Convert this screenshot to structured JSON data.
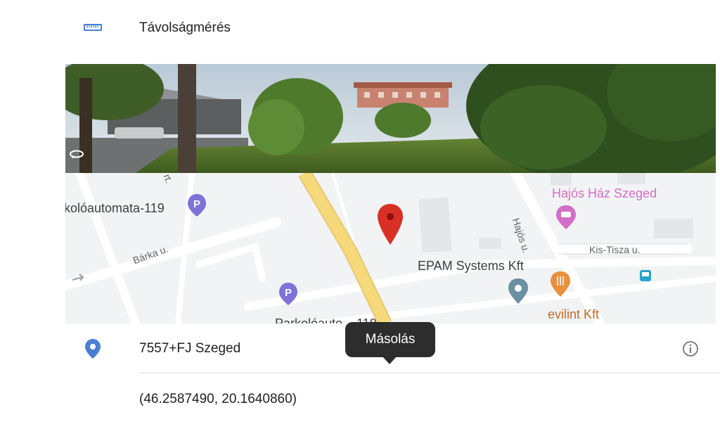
{
  "measure": {
    "label": "Távolságmérés",
    "icon": "ruler-icon"
  },
  "streetview": {
    "icon": "rotate-360-icon"
  },
  "map": {
    "labels": {
      "parking_1": "kolóautomata-119",
      "street_barka": "Bárka u.",
      "street_hajos": "Hajós u.",
      "street_kistisza": "Kis-Tisza u.",
      "street_partial": "rt.",
      "hotel": "Hajós Ház Szeged",
      "epam": "EPAM Systems Kft",
      "restaurant": "evilint Kft",
      "parking_2": "Parkolóauto... 118"
    },
    "colors": {
      "pin": "#d93025",
      "road_major": "#f6d97a",
      "hotel": "#d36fc6",
      "restaurant": "#e8903c",
      "parking": "#7e72d8",
      "place": "#6b8fa3",
      "bus": "#2aa4c9"
    }
  },
  "address": {
    "plus_code": "7557+FJ Szeged",
    "icon": "location-pin-icon",
    "info_icon": "info-icon"
  },
  "coords": {
    "text": "(46.2587490, 20.1640860)"
  },
  "tooltip": {
    "label": "Másolás"
  }
}
